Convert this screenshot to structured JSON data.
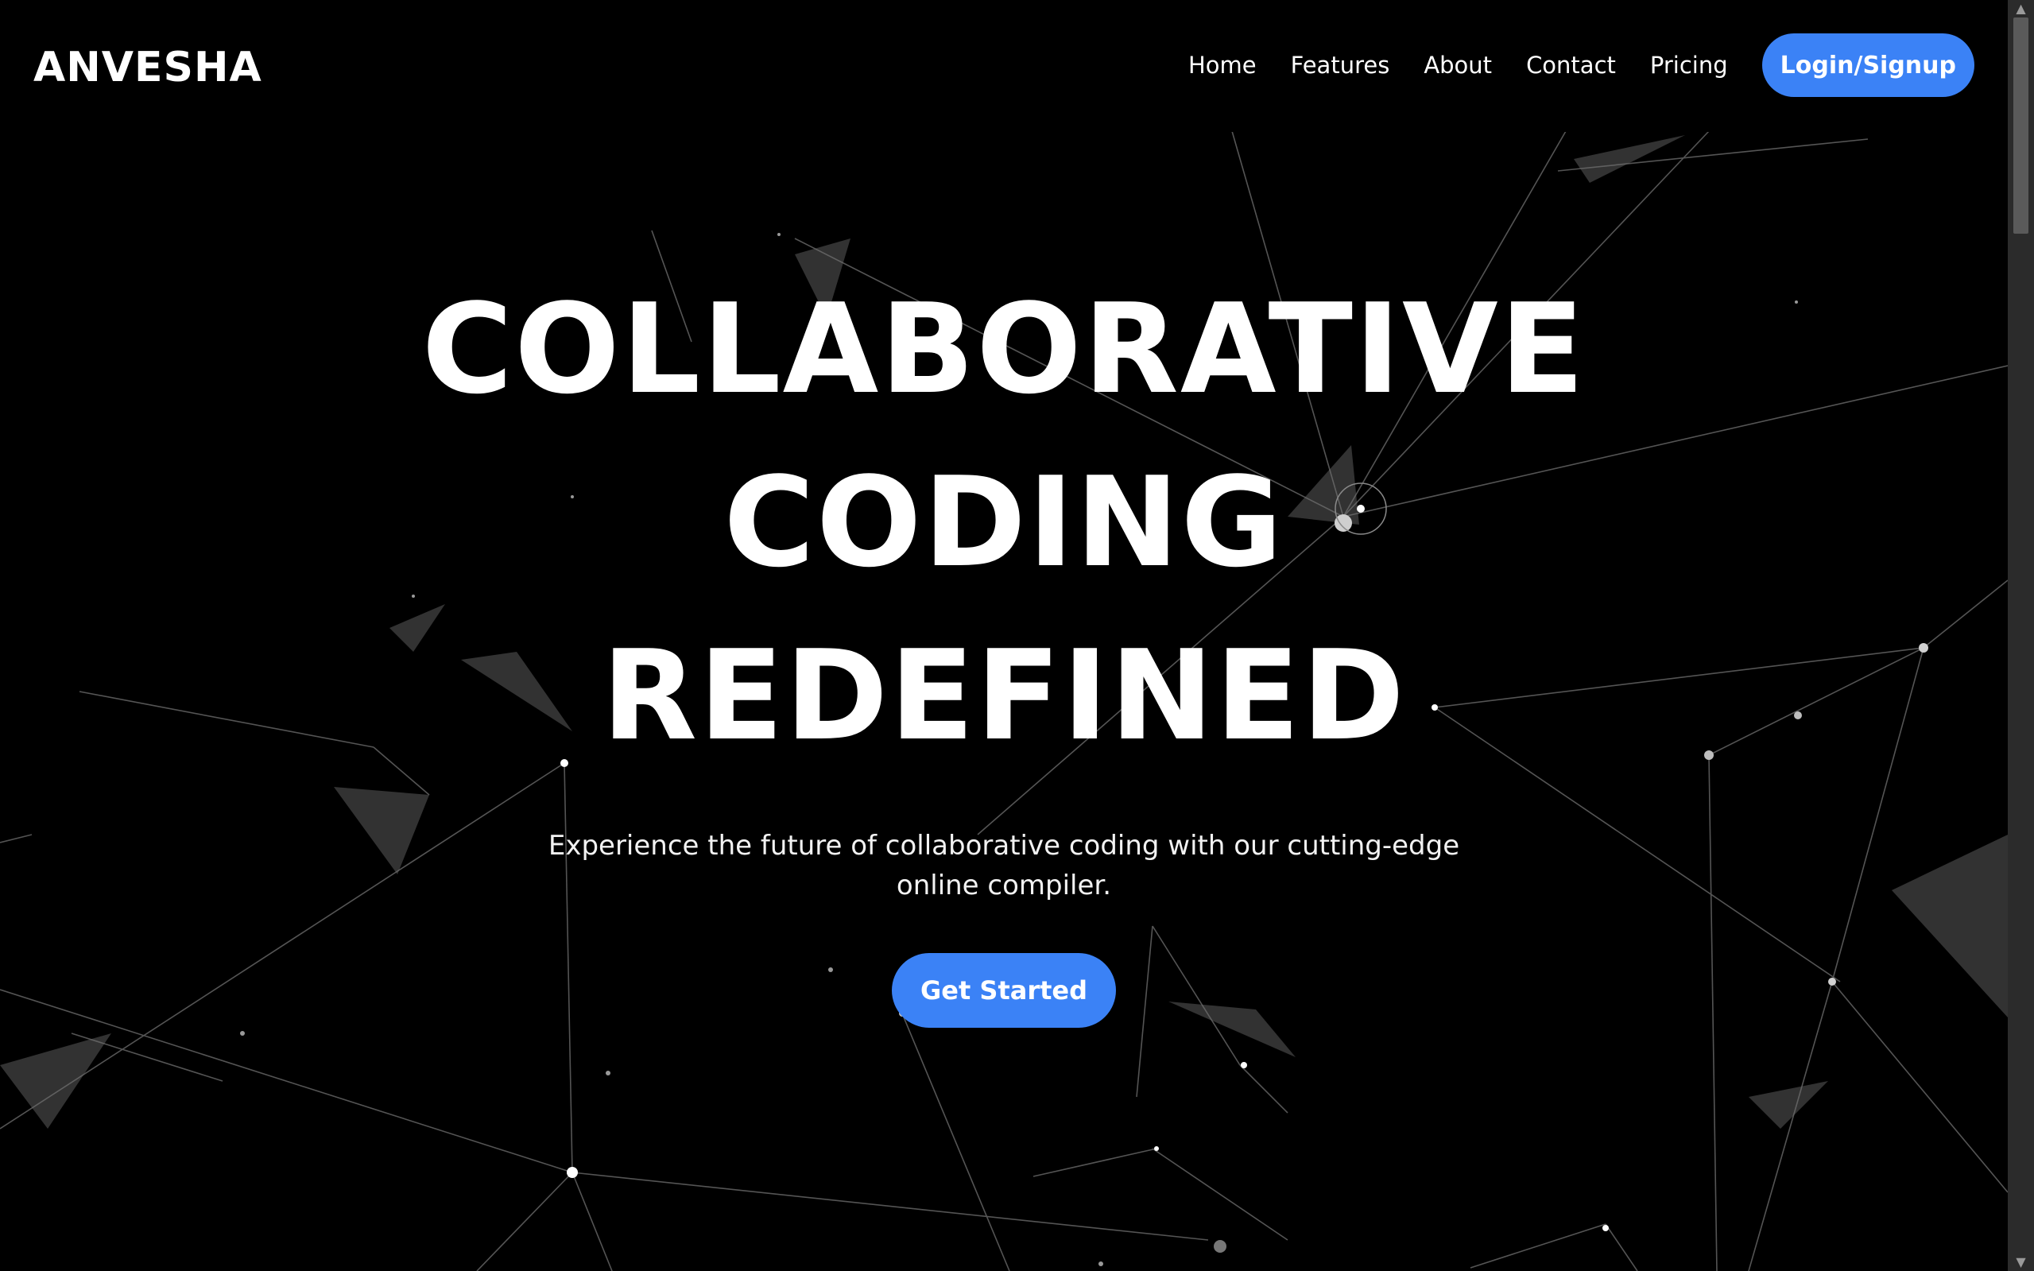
{
  "header": {
    "brand": "ANVESHA",
    "nav": [
      {
        "label": "Home"
      },
      {
        "label": "Features"
      },
      {
        "label": "About"
      },
      {
        "label": "Contact"
      },
      {
        "label": "Pricing"
      }
    ],
    "login_label": "Login/Signup"
  },
  "hero": {
    "title_lines": [
      "COLLABORATIVE",
      "CODING",
      "REDEFINED"
    ],
    "subtitle": "Experience the future of collaborative coding with our cutting-edge online compiler.",
    "cta_label": "Get Started"
  },
  "colors": {
    "background": "#000000",
    "accent": "#3b82f6",
    "text": "#ffffff"
  },
  "scrollbar": {
    "up_icon": "chevron-up-icon",
    "down_icon": "chevron-down-icon"
  }
}
